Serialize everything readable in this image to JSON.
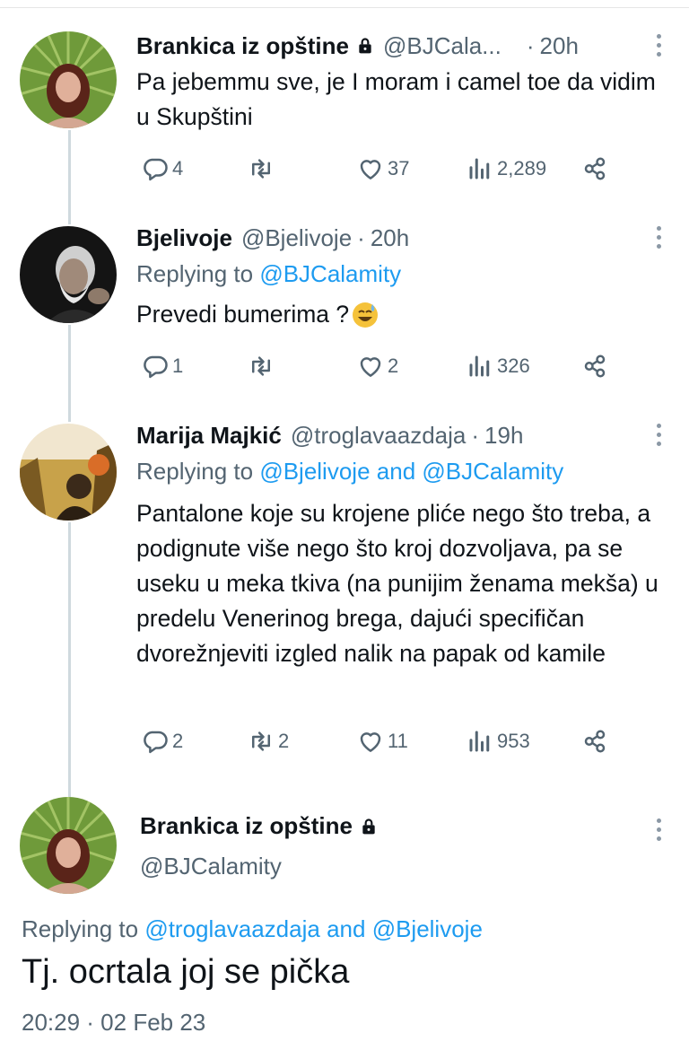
{
  "colors": {
    "link": "#1d9bf0",
    "muted": "#536471",
    "text": "#0f1419",
    "thread_line": "#cfd9de"
  },
  "tweets": [
    {
      "name": "Brankica iz opštine",
      "handle": "@BJCala...",
      "dot": "·",
      "time": "20h",
      "locked": true,
      "text": "Pa jebemmu sve, je I moram i camel toe da vidim u Skupštini",
      "replies": "4",
      "retweets": "",
      "likes": "37",
      "views": "2,289"
    },
    {
      "name": "Bjelivoje",
      "handle": "@Bjelivoje",
      "dot": "·",
      "time": "20h",
      "reply_prefix": "Replying to",
      "reply_mention": "@BJCalamity",
      "text": "Prevedi bumerima ?",
      "emoji": "sweat-smile-emoji",
      "replies": "1",
      "retweets": "",
      "likes": "2",
      "views": "326"
    },
    {
      "name": "Marija Majkić",
      "handle": "@troglavaazdaja",
      "dot": "·",
      "time": "19h",
      "reply_prefix": "Replying to",
      "reply_mention_1": "@Bjelivoje",
      "reply_and": "and",
      "reply_mention_2": "@BJCalamity",
      "text": "Pantalone koje su krojene pliće nego što treba, a podignute više nego što kroj dozvoljava, pa se useku u meka tkiva (na punijim ženama mekša) u predelu Venerinog brega, dajući specifičan dvorežnjeviti izgled nalik na papak od kamile",
      "replies": "2",
      "retweets": "2",
      "likes": "11",
      "views": "953"
    }
  ],
  "main": {
    "name": "Brankica iz opštine",
    "handle": "@BJCalamity",
    "reply_prefix": "Replying to",
    "reply_mention_1": "@troglavaazdaja",
    "reply_and": "and",
    "reply_mention_2": "@Bjelivoje",
    "text": "Tj. ocrtala joj se pička",
    "timestamp": "20:29 · 02 Feb 23"
  },
  "icons": {
    "reply": "reply-icon",
    "retweet": "retweet-icon",
    "like": "heart-icon",
    "views": "views-chart-icon",
    "share": "share-icon",
    "lock": "lock-icon",
    "more": "more-vertical-icon"
  }
}
